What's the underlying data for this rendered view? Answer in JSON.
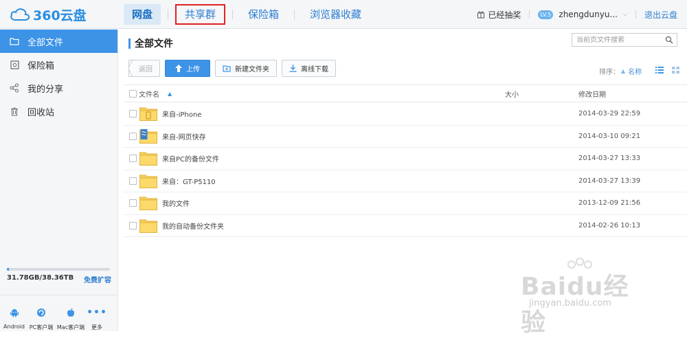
{
  "app": {
    "logo_text": "360云盘",
    "brand_color": "#2a8ee0"
  },
  "nav": {
    "items": [
      {
        "label": "网盘",
        "active": true
      },
      {
        "label": "共享群",
        "highlighted": true
      },
      {
        "label": "保险箱"
      },
      {
        "label": "浏览器收藏"
      }
    ]
  },
  "header_right": {
    "lottery": "已经抽奖",
    "level_badge": "LV.5",
    "username": "zhengdunyu...",
    "logout": "退出云盘"
  },
  "sidebar": {
    "items": [
      {
        "label": "全部文件",
        "icon": "folder-icon",
        "active": true
      },
      {
        "label": "保险箱",
        "icon": "safe-icon"
      },
      {
        "label": "我的分享",
        "icon": "share-icon"
      },
      {
        "label": "回收站",
        "icon": "trash-icon"
      }
    ],
    "quota": {
      "used_text": "31.78GB/38.36TB",
      "fraction": 0.001,
      "link": "免费扩容"
    },
    "clients": [
      {
        "label": "Android",
        "icon": "android-icon"
      },
      {
        "label": "PC客户端",
        "icon": "pc-client-icon"
      },
      {
        "label": "Mac客户端",
        "icon": "apple-icon"
      },
      {
        "label": "更多",
        "icon": "more-icon"
      }
    ]
  },
  "main": {
    "title": "全部文件",
    "search_placeholder": "当前页文件搜索",
    "toolbar": {
      "back": "返回",
      "upload": "上传",
      "new_folder": "新建文件夹",
      "offline_download": "离线下载"
    },
    "sort": {
      "label": "排序：",
      "field": "名称"
    },
    "columns": {
      "name": "文件名",
      "size": "大小",
      "date": "修改日期"
    },
    "files": [
      {
        "name": "来自-iPhone",
        "date": "2014-03-29 22:59",
        "icon": "phone-folder-icon"
      },
      {
        "name": "来自-网页快存",
        "date": "2014-03-10 09:21",
        "icon": "web-folder-icon"
      },
      {
        "name": "来自PC的备份文件",
        "date": "2014-03-27 13:33",
        "icon": "folder-icon"
      },
      {
        "name": "来自：GT-P5110",
        "date": "2014-03-27 13:39",
        "icon": "folder-icon"
      },
      {
        "name": "我的文件",
        "date": "2013-12-09 21:56",
        "icon": "folder-icon"
      },
      {
        "name": "我的自动备份文件夹",
        "date": "2014-02-26 10:13",
        "icon": "folder-icon"
      }
    ]
  },
  "watermark": {
    "text": "Baidu经验",
    "sub": "jingyan.baidu.com"
  }
}
